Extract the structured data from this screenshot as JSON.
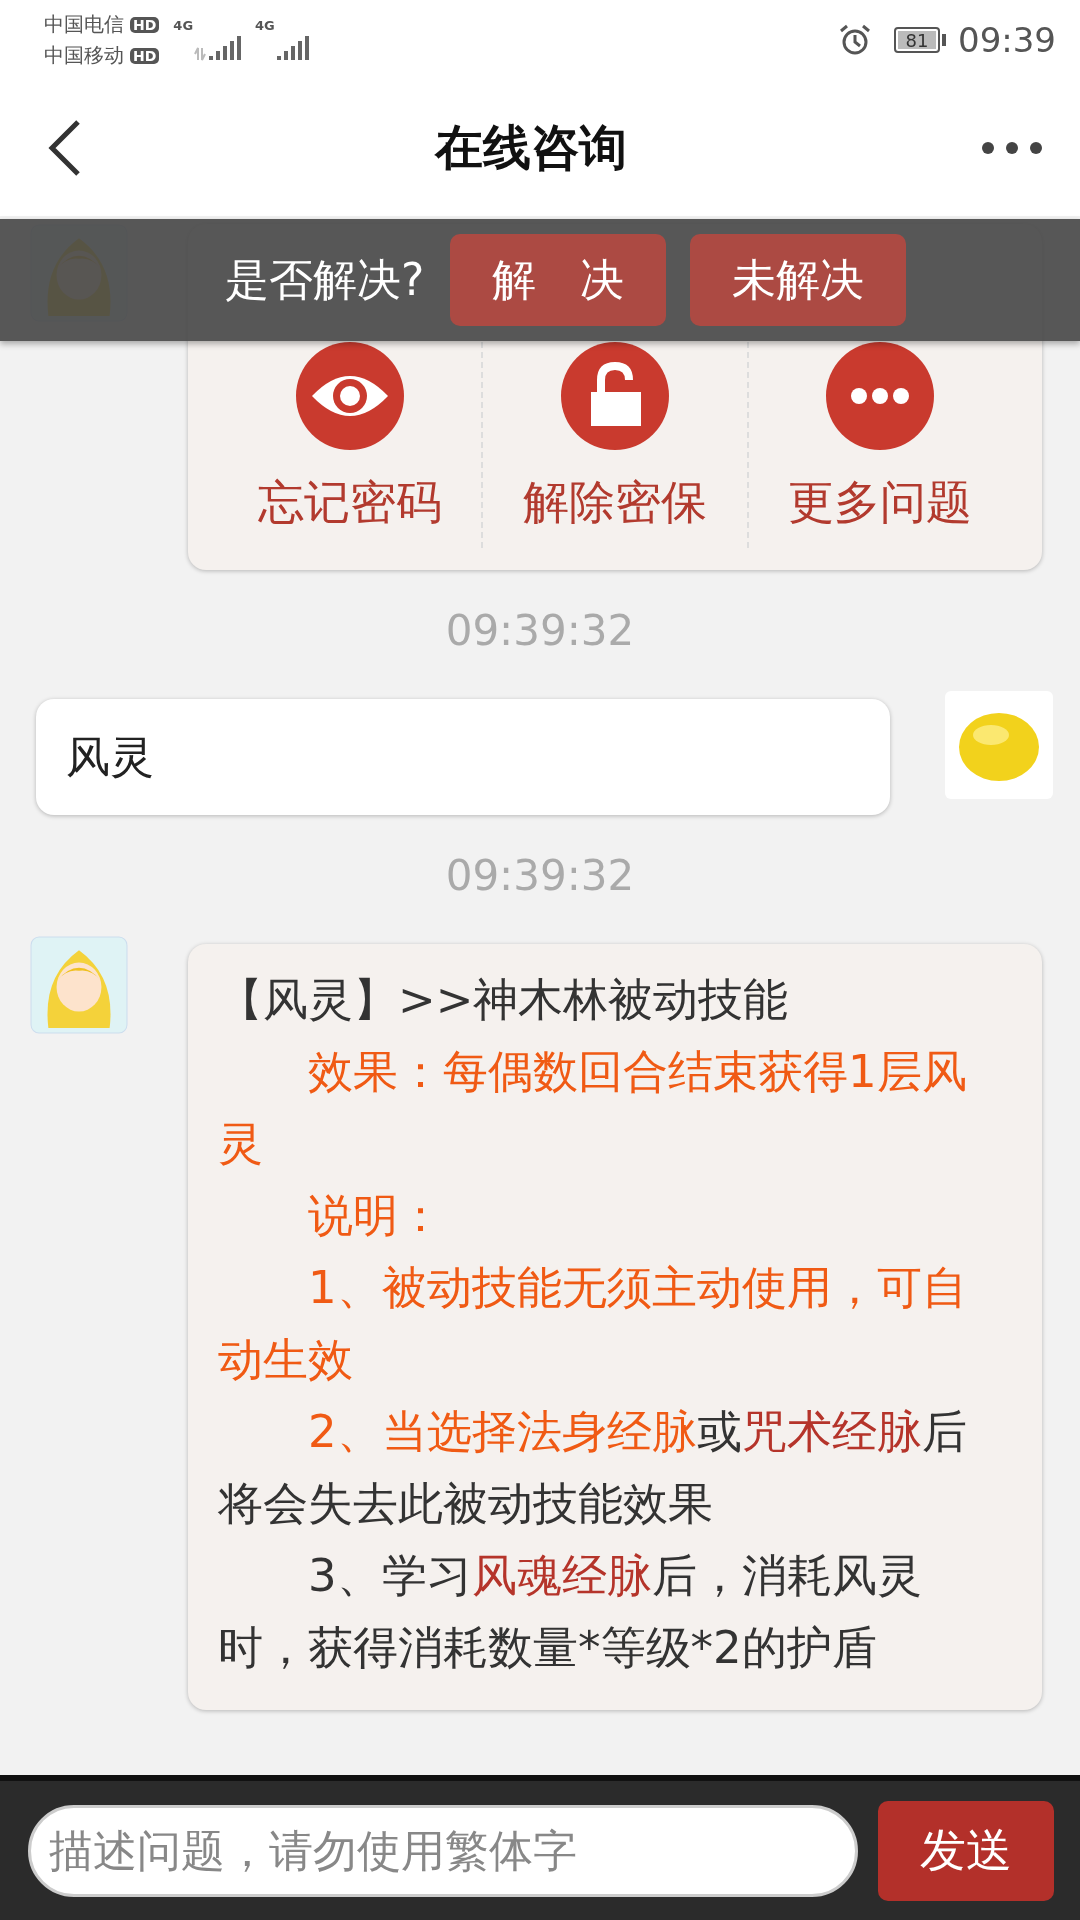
{
  "status_bar": {
    "carriers": [
      {
        "name": "中国电信",
        "badge": "HD"
      },
      {
        "name": "中国移动",
        "badge": "HD"
      }
    ],
    "signals": [
      {
        "network": "4G"
      },
      {
        "network": "4G"
      }
    ],
    "battery": "81",
    "time": "09:39"
  },
  "header": {
    "title": "在线咨询"
  },
  "prompt": {
    "question": "是否解决?",
    "buttons": [
      {
        "label": "解　决"
      },
      {
        "label": "未解决"
      }
    ]
  },
  "messages": [
    {
      "kind": "bot_menu",
      "options": [
        {
          "label": "忘记密码"
        },
        {
          "label": "解除密保"
        },
        {
          "label": "更多问题"
        }
      ]
    },
    {
      "kind": "time",
      "text": "09:39:32"
    },
    {
      "kind": "user",
      "text": "风灵"
    },
    {
      "kind": "time",
      "text": "09:39:32"
    },
    {
      "kind": "bot_text",
      "paragraphs": [
        {
          "indent": false,
          "segments": [
            {
              "text": "【风灵】>>神木林被动技能",
              "color": "#333333"
            }
          ]
        },
        {
          "indent": true,
          "segments": [
            {
              "text": "效果：每偶数回合结束获得1层风灵",
              "color": "#f05a14"
            }
          ]
        },
        {
          "indent": true,
          "segments": [
            {
              "text": "说明：",
              "color": "#f05a14"
            }
          ]
        },
        {
          "indent": true,
          "segments": [
            {
              "text": "1、被动技能无须主动使用，可自动生效",
              "color": "#f05a14"
            }
          ]
        },
        {
          "indent": true,
          "segments": [
            {
              "text": "2、当选择法身经脉",
              "color": "#f05a14"
            },
            {
              "text": "或",
              "color": "#333333"
            },
            {
              "text": "咒术经脉",
              "color": "#b5342a"
            },
            {
              "text": "后将会失去此被动技能效果",
              "color": "#333333"
            }
          ]
        },
        {
          "indent": true,
          "segments": [
            {
              "text": "3、学习",
              "color": "#333333"
            },
            {
              "text": "风魂经脉",
              "color": "#b5342a"
            },
            {
              "text": "后，消耗风灵时，获得消耗数量*等级*2的护盾",
              "color": "#333333"
            }
          ]
        }
      ]
    }
  ],
  "composer": {
    "placeholder": "描述问题，请勿使用繁体字",
    "send": "发送"
  }
}
